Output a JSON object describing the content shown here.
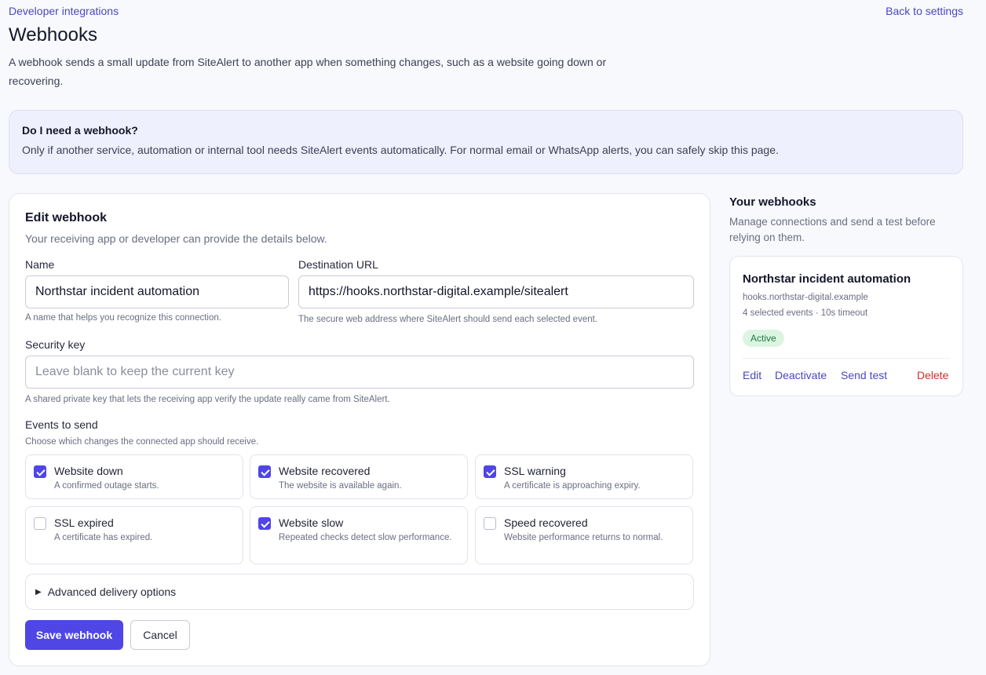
{
  "header": {
    "breadcrumb": "Developer integrations",
    "back_link": "Back to settings",
    "title": "Webhooks",
    "intro": "A webhook sends a small update from SiteAlert to another app when something changes, such as a website going down or recovering."
  },
  "info": {
    "title": "Do I need a webhook?",
    "text": "Only if another service, automation or internal tool needs SiteAlert events automatically. For normal email or WhatsApp alerts, you can safely skip this page."
  },
  "form": {
    "title": "Edit webhook",
    "subtitle": "Your receiving app or developer can provide the details below.",
    "name": {
      "label": "Name",
      "value": "Northstar incident automation",
      "help": "A name that helps you recognize this connection."
    },
    "url": {
      "label": "Destination URL",
      "value": "https://hooks.northstar-digital.example/sitealert",
      "help": "The secure web address where SiteAlert should send each selected event."
    },
    "security": {
      "label": "Security key",
      "placeholder": "Leave blank to keep the current key",
      "help": "A shared private key that lets the receiving app verify the update really came from SiteAlert."
    },
    "events": {
      "label": "Events to send",
      "help": "Choose which changes the connected app should receive.",
      "items": [
        {
          "title": "Website down",
          "desc": "A confirmed outage starts.",
          "checked": true
        },
        {
          "title": "Website recovered",
          "desc": "The website is available again.",
          "checked": true
        },
        {
          "title": "SSL warning",
          "desc": "A certificate is approaching expiry.",
          "checked": true
        },
        {
          "title": "SSL expired",
          "desc": "A certificate has expired.",
          "checked": false
        },
        {
          "title": "Website slow",
          "desc": "Repeated checks detect slow performance.",
          "checked": true
        },
        {
          "title": "Speed recovered",
          "desc": "Website performance returns to normal.",
          "checked": false
        }
      ]
    },
    "advanced_label": "Advanced delivery options",
    "save_label": "Save webhook",
    "cancel_label": "Cancel"
  },
  "sidebar": {
    "title": "Your webhooks",
    "subtitle": "Manage connections and send a test before relying on them.",
    "hook": {
      "name": "Northstar incident automation",
      "host": "hooks.northstar-digital.example",
      "meta": "4 selected events · 10s timeout",
      "status": "Active",
      "actions": {
        "edit": "Edit",
        "deactivate": "Deactivate",
        "send_test": "Send test",
        "delete": "Delete"
      }
    }
  }
}
